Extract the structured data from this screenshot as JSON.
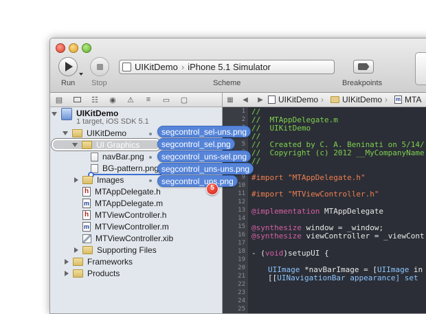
{
  "window": {
    "title": ""
  },
  "toolbar": {
    "run_label": "Run",
    "stop_label": "Stop",
    "scheme_label": "Scheme",
    "breakpoints_label": "Breakpoints",
    "scheme_target": "UIKitDemo",
    "scheme_destination": "iPhone 5.1 Simulator"
  },
  "jump_bar": {
    "items": [
      "UIKitDemo",
      "UIKitDemo",
      "MTA"
    ]
  },
  "project": {
    "name": "UIKitDemo",
    "subtitle": "1 target, iOS SDK 5.1"
  },
  "navigator": {
    "items": [
      {
        "label": "UIKitDemo",
        "kind": "folder",
        "expanded": true
      },
      {
        "label": "UI Graphics",
        "kind": "folder",
        "expanded": true
      },
      {
        "label": "navBar.png",
        "kind": "png"
      },
      {
        "label": "BG-pattern.png",
        "kind": "png"
      },
      {
        "label": "Images",
        "kind": "folder",
        "expanded": false
      },
      {
        "label": "MTAppDelegate.h",
        "kind": "h"
      },
      {
        "label": "MTAppDelegate.m",
        "kind": "m"
      },
      {
        "label": "MTViewController.h",
        "kind": "h"
      },
      {
        "label": "MTViewController.m",
        "kind": "m"
      },
      {
        "label": "MTViewController.xib",
        "kind": "xib"
      },
      {
        "label": "Supporting Files",
        "kind": "folder",
        "expanded": false
      },
      {
        "label": "Frameworks",
        "kind": "folder",
        "expanded": false
      },
      {
        "label": "Products",
        "kind": "folder",
        "expanded": false
      }
    ]
  },
  "drag": {
    "files": [
      "segcontrol_sel-uns.png",
      "segcontrol_sel.png",
      "segcontrol_uns-sel.png",
      "segcontrol_uns-uns.png",
      "segcontrol_uns.png"
    ],
    "count": "5"
  },
  "editor": {
    "line_numbers": [
      "1",
      "2",
      "3",
      "4",
      "5",
      "6",
      "7",
      "8",
      "9",
      "10",
      "11",
      "12",
      "13",
      "14",
      "15",
      "16",
      "17",
      "18",
      "19",
      "20",
      "21",
      "22",
      "23",
      "24",
      "25"
    ],
    "comment_lines": [
      "//",
      "//  MTAppDelegate.m",
      "//  UIKitDemo",
      "//",
      "//  Created by C. A. Beninati on 5/14/",
      "//  Copyright (c) 2012 __MyCompanyName",
      "//"
    ],
    "import_kw": "#import",
    "import1": "\"MTAppDelegate.h\"",
    "import2": "\"MTViewController.h\"",
    "impl_kw": "@implementation",
    "impl_name": " MTAppDelegate",
    "synth_kw": "@synthesize",
    "synth1": " window = _window;",
    "synth2": " viewController = _viewCont",
    "method_prefix": "- (",
    "method_void": "void",
    "method_rest": ")setupUI {",
    "line_a_type": "UIImage",
    "line_a_rest": " *navBarImage = [",
    "line_a_type2": "UIImage",
    "line_a_tail": " in",
    "line_b_open": "[[",
    "line_b_type": "UINavigationBar",
    "line_b_mid": " ",
    "line_b_kw": "appearance",
    "line_b_tail": "] set"
  },
  "colors": {
    "comment": "#7fd04f",
    "preprocessor": "#f07f52",
    "keyword": "#d65fa6",
    "type": "#8ec5ff",
    "drag_label": "#5584d9",
    "badge": "#cc1d12"
  }
}
